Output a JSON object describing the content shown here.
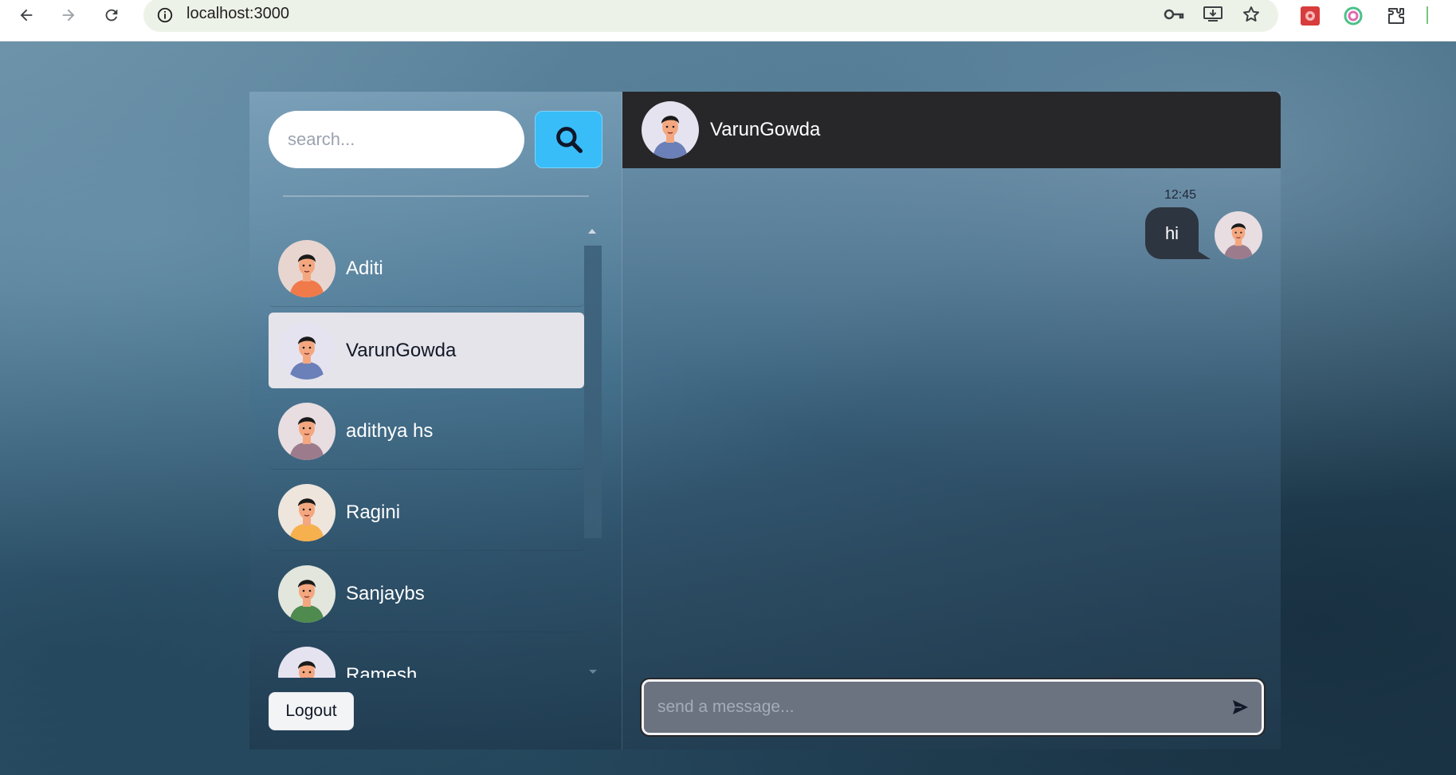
{
  "browser": {
    "url": "localhost:3000",
    "icons": [
      "back-icon",
      "forward-icon",
      "reload-icon",
      "site-info-icon",
      "key-icon",
      "install-icon",
      "star-icon",
      "extensions-icon"
    ]
  },
  "sidebar": {
    "search_placeholder": "search...",
    "contacts": [
      {
        "name": "Aditi",
        "avatar_bg": "#e8d5d0",
        "shirt": "#f07a4a",
        "hair": "#1a1a1a"
      },
      {
        "name": "VarunGowda",
        "avatar_bg": "#e6e3f0",
        "shirt": "#6b7fb8",
        "hair": "#1a1a1a"
      },
      {
        "name": "adithya hs",
        "avatar_bg": "#e8dde0",
        "shirt": "#9c7b8c",
        "hair": "#1a1a1a"
      },
      {
        "name": "Ragini",
        "avatar_bg": "#eee5dc",
        "shirt": "#f6b04e",
        "hair": "#1a1a1a"
      },
      {
        "name": "Sanjaybs",
        "avatar_bg": "#e3e6dc",
        "shirt": "#4f8a4f",
        "hair": "#1a1a1a"
      },
      {
        "name": "Ramesh",
        "avatar_bg": "#e6e3f0",
        "shirt": "#8a86d8",
        "hair": "#1a1a1a"
      }
    ],
    "selected_index": 1,
    "logout_label": "Logout"
  },
  "chat": {
    "header_name": "VarunGowda",
    "messages": [
      {
        "text": "hi",
        "time": "12:45",
        "from_self": true
      }
    ],
    "input_placeholder": "send a message..."
  },
  "colors": {
    "search_button": "#38bdf8",
    "chat_header": "#27272a",
    "bubble": "#2d3540",
    "selected_contact": "#e5e4ea"
  }
}
